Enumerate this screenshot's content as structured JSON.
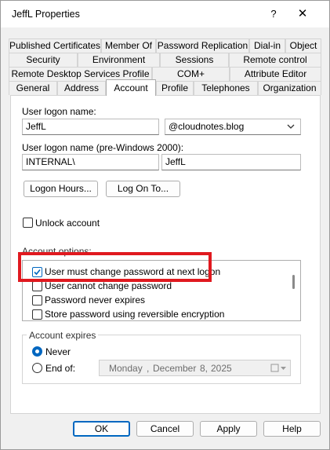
{
  "window": {
    "title": "JeffL Properties",
    "help_glyph": "?",
    "close_glyph": "✕"
  },
  "tabs": {
    "row1": [
      "Published Certificates",
      "Member Of",
      "Password Replication",
      "Dial-in",
      "Object"
    ],
    "row2": [
      "Security",
      "Environment",
      "Sessions",
      "Remote control"
    ],
    "row3": [
      "Remote Desktop Services Profile",
      "COM+",
      "Attribute Editor"
    ],
    "row4": [
      "General",
      "Address",
      "Account",
      "Profile",
      "Telephones",
      "Organization"
    ],
    "active": "Account"
  },
  "account": {
    "logon_label": "User logon name:",
    "logon_value": "JeffL",
    "domain_value": "@cloudnotes.blog",
    "pre2000_label": "User logon name (pre-Windows 2000):",
    "pre2000_domain": "INTERNAL\\",
    "pre2000_user": "JeffL",
    "logon_hours_button": "Logon Hours...",
    "logon_to_button": "Log On To...",
    "unlock_label": "Unlock account",
    "unlock_checked": false,
    "options_title": "Account options:",
    "options": [
      {
        "label": "User must change password at next logon",
        "checked": true
      },
      {
        "label": "User cannot change password",
        "checked": false
      },
      {
        "label": "Password never expires",
        "checked": false
      },
      {
        "label": "Store password using reversible encryption",
        "checked": false
      }
    ],
    "expires_title": "Account expires",
    "never_label": "Never",
    "end_of_label": "End of:",
    "selected_expiry": "Never",
    "date": {
      "weekday": "Monday",
      "sep": ",",
      "month": "December",
      "day": "8,",
      "year": "2025"
    }
  },
  "footer": {
    "ok": "OK",
    "cancel": "Cancel",
    "apply": "Apply",
    "help": "Help"
  },
  "colors": {
    "accent": "#0067c0",
    "highlight": "#e0191f"
  }
}
